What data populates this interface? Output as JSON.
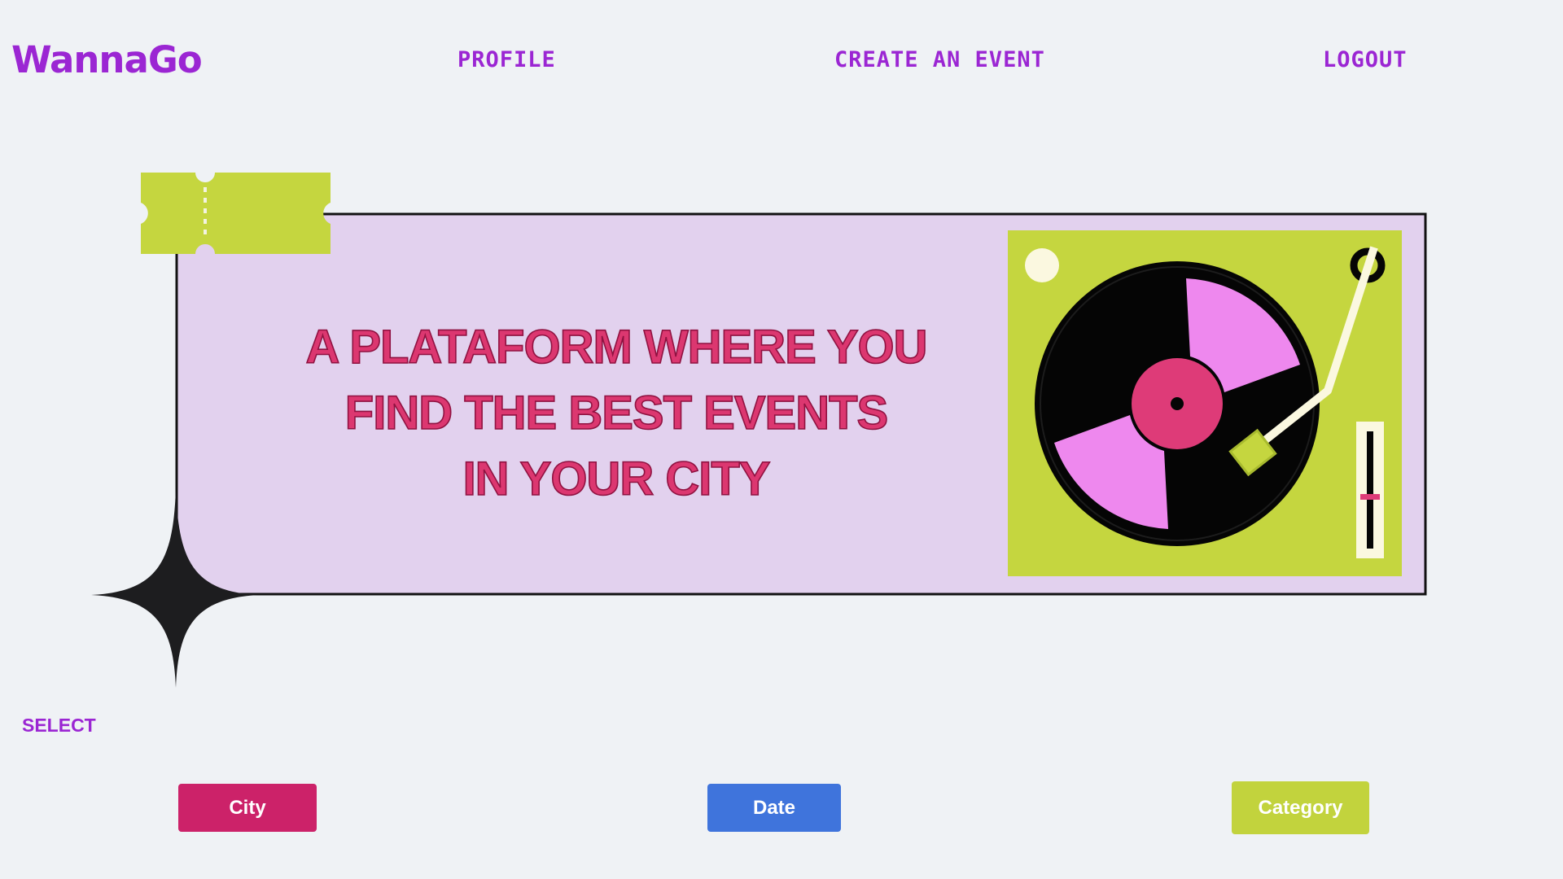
{
  "header": {
    "logo": "WannaGo",
    "nav": {
      "profile": "PROFILE",
      "create_event": "CREATE AN EVENT",
      "logout": "LOGOUT"
    }
  },
  "hero": {
    "headline_lines": [
      "A PLATAFORM WHERE YOU",
      "FIND THE BEST EVENTS",
      "IN YOUR CITY"
    ]
  },
  "filters": {
    "label": "SELECT",
    "city": "City",
    "date": "Date",
    "category": "Category"
  },
  "colors": {
    "brand_purple": "#9b26d3",
    "city_pink": "#cc2269",
    "date_blue": "#3f74dc",
    "category_lime": "#c2d33d",
    "hero_lavender": "#e2d1ee"
  }
}
